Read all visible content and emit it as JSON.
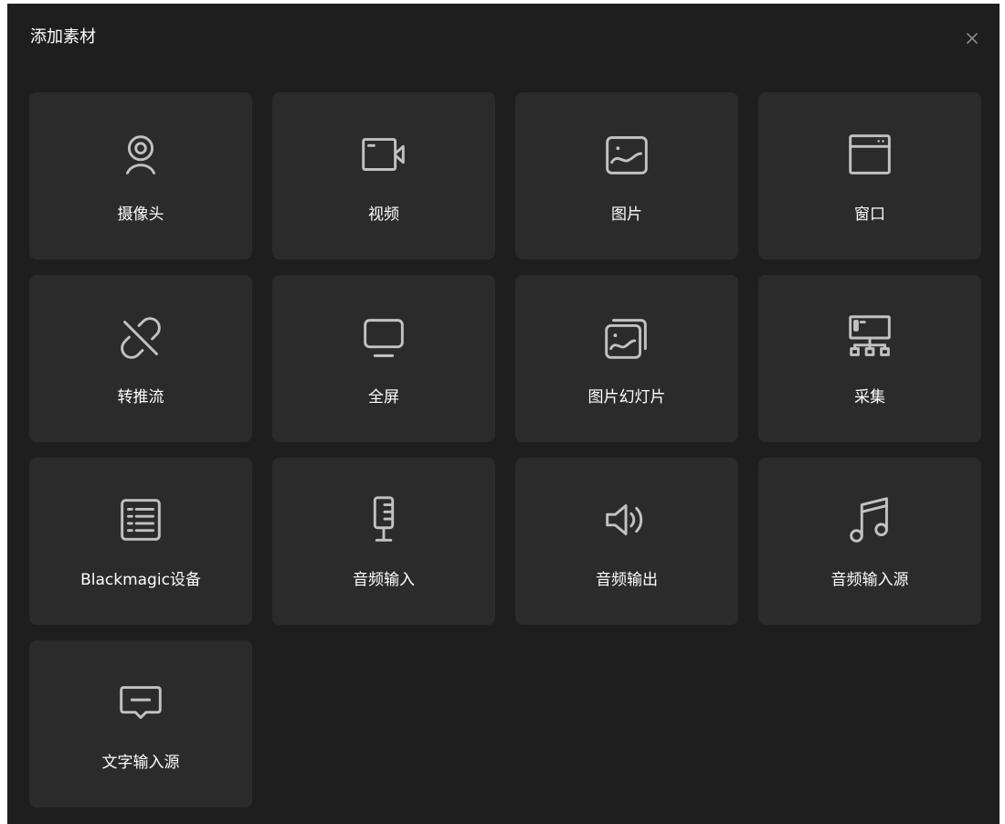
{
  "dialog": {
    "title": "添加素材",
    "close_icon": "close-icon",
    "accent_background": "#1e1e1e",
    "tile_background": "#2b2b2b",
    "icon_color": "#c2c2c2"
  },
  "tiles": [
    {
      "label": "摄像头",
      "icon": "webcam-icon"
    },
    {
      "label": "视频",
      "icon": "video-camera-icon"
    },
    {
      "label": "图片",
      "icon": "image-icon"
    },
    {
      "label": "窗口",
      "icon": "window-icon"
    },
    {
      "label": "转推流",
      "icon": "broken-link-icon"
    },
    {
      "label": "全屏",
      "icon": "monitor-icon"
    },
    {
      "label": "图片幻灯片",
      "icon": "image-stack-icon"
    },
    {
      "label": "采集",
      "icon": "capture-device-icon"
    },
    {
      "label": "Blackmagic设备",
      "icon": "device-list-icon"
    },
    {
      "label": "音频输入",
      "icon": "microphone-icon"
    },
    {
      "label": "音频输出",
      "icon": "speaker-icon"
    },
    {
      "label": "音频输入源",
      "icon": "music-note-icon"
    },
    {
      "label": "文字输入源",
      "icon": "text-message-icon"
    }
  ]
}
